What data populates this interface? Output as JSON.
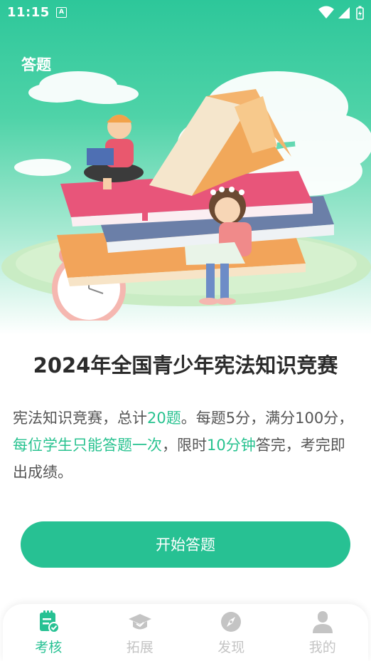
{
  "status_bar": {
    "time": "11:15",
    "notification": "A"
  },
  "header": {
    "title": "答题"
  },
  "contest": {
    "title": "2024年全国青少年宪法知识竞赛"
  },
  "description": {
    "part1": "宪法知识竞赛，总计",
    "questions": "20题",
    "part2": "。每题5分，满分100分，",
    "rule": "每位学生只能答题一次",
    "part3": "，限时",
    "time_limit": "10分钟",
    "part4": "答完，考完即出成绩。"
  },
  "start_button": {
    "label": "开始答题"
  },
  "tabbar": {
    "items": [
      {
        "label": "考核",
        "icon": "clipboard-check-icon",
        "active": true
      },
      {
        "label": "拓展",
        "icon": "graduation-cap-icon",
        "active": false
      },
      {
        "label": "发现",
        "icon": "compass-icon",
        "active": false
      },
      {
        "label": "我的",
        "icon": "user-icon",
        "active": false
      }
    ]
  },
  "colors": {
    "accent": "#27c193",
    "hero_top": "#2dc79a",
    "inactive": "#c4c4c4"
  }
}
